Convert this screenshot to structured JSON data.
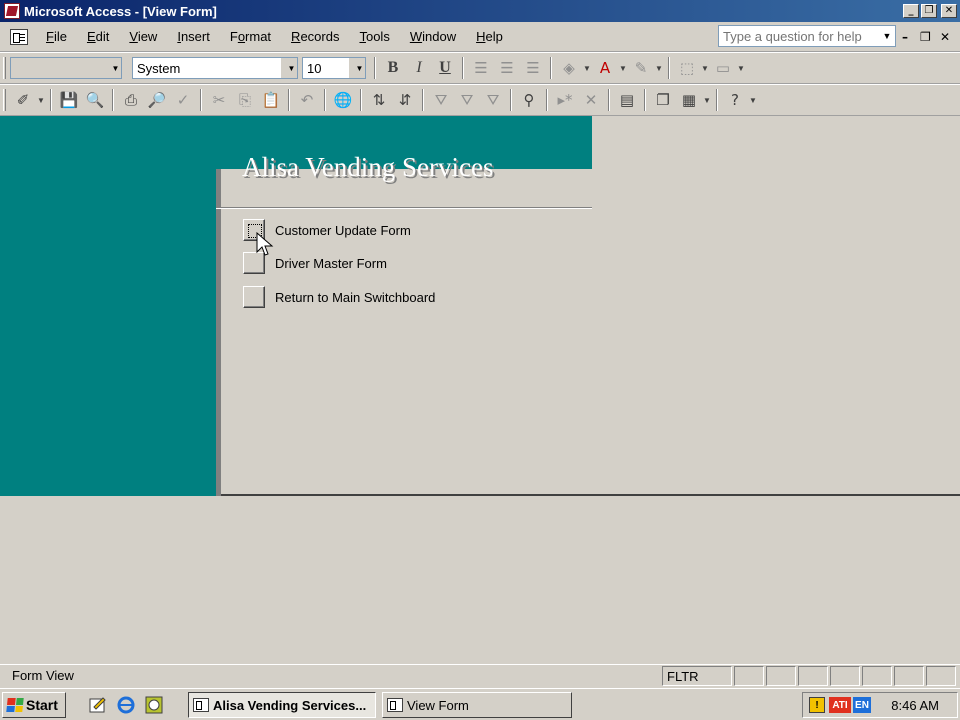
{
  "window": {
    "title": "Microsoft Access - [View Form]"
  },
  "menu": {
    "items": [
      {
        "label": "File",
        "key": "F"
      },
      {
        "label": "Edit",
        "key": "E"
      },
      {
        "label": "View",
        "key": "V"
      },
      {
        "label": "Insert",
        "key": "I"
      },
      {
        "label": "Format",
        "key": "o"
      },
      {
        "label": "Records",
        "key": "R"
      },
      {
        "label": "Tools",
        "key": "T"
      },
      {
        "label": "Window",
        "key": "W"
      },
      {
        "label": "Help",
        "key": "H"
      }
    ],
    "help_placeholder": "Type a question for help"
  },
  "formatting_toolbar": {
    "object_combo": "",
    "font_name": "System",
    "font_size": "10",
    "bold": "B",
    "italic": "I",
    "underline": "U"
  },
  "form": {
    "header_title": "Alisa Vending Services",
    "items": [
      {
        "label": "Customer Update Form"
      },
      {
        "label": "Driver Master Form"
      },
      {
        "label": "Return to Main Switchboard"
      }
    ]
  },
  "status": {
    "mode": "Form View",
    "filter": "FLTR"
  },
  "taskbar": {
    "start_label": "Start",
    "tasks": [
      {
        "label": "Alisa Vending Services..."
      },
      {
        "label": "View Form"
      }
    ],
    "tray_lang": "EN",
    "clock": "8:46 AM"
  },
  "colors": {
    "teal": "#008080",
    "titlebar": "#0a246a"
  }
}
